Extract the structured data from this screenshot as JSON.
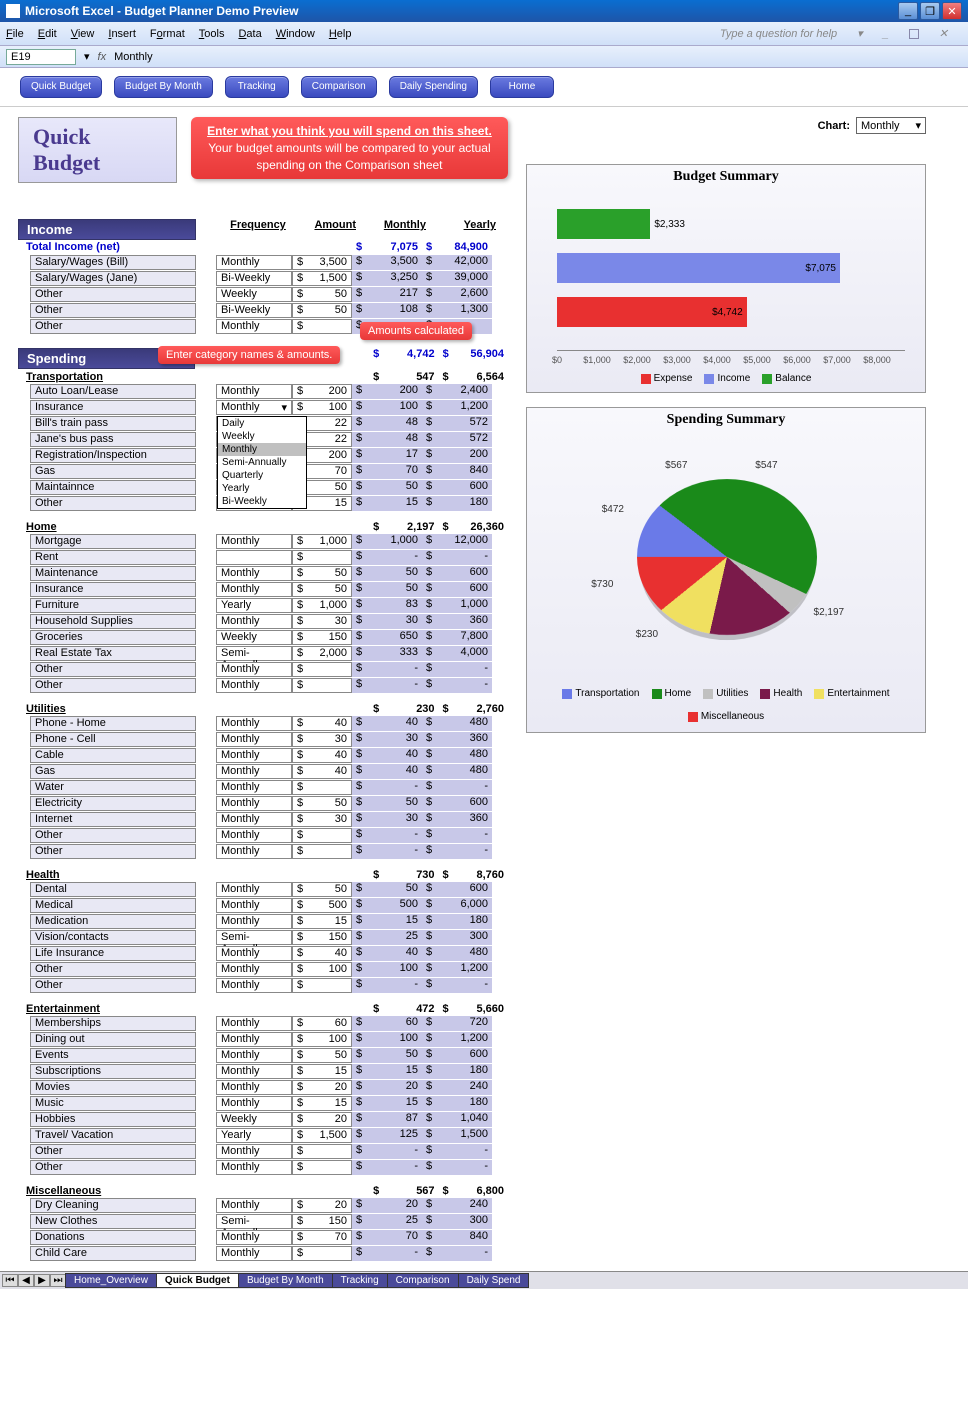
{
  "window": {
    "title": "Microsoft Excel - Budget Planner Demo Preview"
  },
  "menu": {
    "file": "File",
    "edit": "Edit",
    "view": "View",
    "insert": "Insert",
    "format": "Format",
    "tools": "Tools",
    "data": "Data",
    "window": "Window",
    "help": "Help",
    "question": "Type a question for help"
  },
  "formula": {
    "ref": "E19",
    "fx": "fx",
    "value": "Monthly"
  },
  "nav": {
    "quick": "Quick Budget",
    "month": "Budget By Month",
    "tracking": "Tracking",
    "comparison": "Comparison",
    "daily": "Daily Spending",
    "home": "Home"
  },
  "callouts": {
    "main_bold": "Enter what you think you will spend on this sheet.",
    "main_text": "Your budget amounts will be compared to your actual spending on the Comparison sheet",
    "amounts": "Amounts calculated",
    "categories": "Enter category names & amounts."
  },
  "page": {
    "title": "Quick Budget",
    "chart_label": "Chart:",
    "chart_value": "Monthly"
  },
  "headers": {
    "freq": "Frequency",
    "amount": "Amount",
    "monthly": "Monthly",
    "yearly": "Yearly"
  },
  "income": {
    "title": "Income",
    "total_label": "Total Income (net)",
    "total_monthly": "7,075",
    "total_yearly": "84,900",
    "rows": [
      {
        "name": "Salary/Wages (Bill)",
        "freq": "Monthly",
        "amount": "3,500",
        "monthly": "3,500",
        "yearly": "42,000"
      },
      {
        "name": "Salary/Wages (Jane)",
        "freq": "Bi-Weekly",
        "amount": "1,500",
        "monthly": "3,250",
        "yearly": "39,000"
      },
      {
        "name": "Other",
        "freq": "Weekly",
        "amount": "50",
        "monthly": "217",
        "yearly": "2,600"
      },
      {
        "name": "Other",
        "freq": "Bi-Weekly",
        "amount": "50",
        "monthly": "108",
        "yearly": "1,300"
      },
      {
        "name": "Other",
        "freq": "Monthly",
        "amount": "",
        "monthly": "",
        "yearly": ""
      }
    ]
  },
  "spending": {
    "title": "Spending",
    "total_monthly": "4,742",
    "total_yearly": "56,904"
  },
  "dropdown_options": [
    "Daily",
    "Weekly",
    "Monthly",
    "Semi-Annually",
    "Quarterly",
    "Yearly",
    "Bi-Weekly"
  ],
  "categories": [
    {
      "name": "Transportation",
      "monthly": "547",
      "yearly": "6,564",
      "rows": [
        {
          "name": "Auto Loan/Lease",
          "freq": "Monthly",
          "amount": "200",
          "monthly": "200",
          "yearly": "2,400"
        },
        {
          "name": "Insurance",
          "freq": "Monthly",
          "amount": "100",
          "monthly": "100",
          "yearly": "1,200",
          "dropdown": true
        },
        {
          "name": "Bill's train pass",
          "freq": "",
          "amount": "22",
          "monthly": "48",
          "yearly": "572"
        },
        {
          "name": "Jane's bus pass",
          "freq": "",
          "amount": "22",
          "monthly": "48",
          "yearly": "572"
        },
        {
          "name": "Registration/Inspection",
          "freq": "",
          "amount": "200",
          "monthly": "17",
          "yearly": "200"
        },
        {
          "name": "Gas",
          "freq": "",
          "amount": "70",
          "monthly": "70",
          "yearly": "840"
        },
        {
          "name": "Maintainnce",
          "freq": "",
          "amount": "50",
          "monthly": "50",
          "yearly": "600"
        },
        {
          "name": "Other",
          "freq": "Monthly",
          "amount": "15",
          "monthly": "15",
          "yearly": "180"
        }
      ]
    },
    {
      "name": "Home",
      "monthly": "2,197",
      "yearly": "26,360",
      "rows": [
        {
          "name": "Mortgage",
          "freq": "Monthly",
          "amount": "1,000",
          "monthly": "1,000",
          "yearly": "12,000"
        },
        {
          "name": "Rent",
          "freq": "",
          "amount": "",
          "monthly": "-",
          "yearly": "-"
        },
        {
          "name": "Maintenance",
          "freq": "Monthly",
          "amount": "50",
          "monthly": "50",
          "yearly": "600"
        },
        {
          "name": "Insurance",
          "freq": "Monthly",
          "amount": "50",
          "monthly": "50",
          "yearly": "600"
        },
        {
          "name": "Furniture",
          "freq": "Yearly",
          "amount": "1,000",
          "monthly": "83",
          "yearly": "1,000"
        },
        {
          "name": "Household Supplies",
          "freq": "Monthly",
          "amount": "30",
          "monthly": "30",
          "yearly": "360"
        },
        {
          "name": "Groceries",
          "freq": "Weekly",
          "amount": "150",
          "monthly": "650",
          "yearly": "7,800"
        },
        {
          "name": "Real Estate Tax",
          "freq": "Semi-Annually",
          "amount": "2,000",
          "monthly": "333",
          "yearly": "4,000"
        },
        {
          "name": "Other",
          "freq": "Monthly",
          "amount": "",
          "monthly": "-",
          "yearly": "-"
        },
        {
          "name": "Other",
          "freq": "Monthly",
          "amount": "",
          "monthly": "-",
          "yearly": "-"
        }
      ]
    },
    {
      "name": "Utilities",
      "monthly": "230",
      "yearly": "2,760",
      "rows": [
        {
          "name": "Phone - Home",
          "freq": "Monthly",
          "amount": "40",
          "monthly": "40",
          "yearly": "480"
        },
        {
          "name": "Phone - Cell",
          "freq": "Monthly",
          "amount": "30",
          "monthly": "30",
          "yearly": "360"
        },
        {
          "name": "Cable",
          "freq": "Monthly",
          "amount": "40",
          "monthly": "40",
          "yearly": "480"
        },
        {
          "name": "Gas",
          "freq": "Monthly",
          "amount": "40",
          "monthly": "40",
          "yearly": "480"
        },
        {
          "name": "Water",
          "freq": "Monthly",
          "amount": "",
          "monthly": "-",
          "yearly": "-"
        },
        {
          "name": "Electricity",
          "freq": "Monthly",
          "amount": "50",
          "monthly": "50",
          "yearly": "600"
        },
        {
          "name": "Internet",
          "freq": "Monthly",
          "amount": "30",
          "monthly": "30",
          "yearly": "360"
        },
        {
          "name": "Other",
          "freq": "Monthly",
          "amount": "",
          "monthly": "-",
          "yearly": "-"
        },
        {
          "name": "Other",
          "freq": "Monthly",
          "amount": "",
          "monthly": "-",
          "yearly": "-"
        }
      ]
    },
    {
      "name": "Health",
      "monthly": "730",
      "yearly": "8,760",
      "rows": [
        {
          "name": "Dental",
          "freq": "Monthly",
          "amount": "50",
          "monthly": "50",
          "yearly": "600"
        },
        {
          "name": "Medical",
          "freq": "Monthly",
          "amount": "500",
          "monthly": "500",
          "yearly": "6,000"
        },
        {
          "name": "Medication",
          "freq": "Monthly",
          "amount": "15",
          "monthly": "15",
          "yearly": "180"
        },
        {
          "name": "Vision/contacts",
          "freq": "Semi-Annually",
          "amount": "150",
          "monthly": "25",
          "yearly": "300"
        },
        {
          "name": "Life Insurance",
          "freq": "Monthly",
          "amount": "40",
          "monthly": "40",
          "yearly": "480"
        },
        {
          "name": "Other",
          "freq": "Monthly",
          "amount": "100",
          "monthly": "100",
          "yearly": "1,200"
        },
        {
          "name": "Other",
          "freq": "Monthly",
          "amount": "",
          "monthly": "-",
          "yearly": "-"
        }
      ]
    },
    {
      "name": "Entertainment",
      "monthly": "472",
      "yearly": "5,660",
      "rows": [
        {
          "name": "Memberships",
          "freq": "Monthly",
          "amount": "60",
          "monthly": "60",
          "yearly": "720"
        },
        {
          "name": "Dining out",
          "freq": "Monthly",
          "amount": "100",
          "monthly": "100",
          "yearly": "1,200"
        },
        {
          "name": "Events",
          "freq": "Monthly",
          "amount": "50",
          "monthly": "50",
          "yearly": "600"
        },
        {
          "name": "Subscriptions",
          "freq": "Monthly",
          "amount": "15",
          "monthly": "15",
          "yearly": "180"
        },
        {
          "name": "Movies",
          "freq": "Monthly",
          "amount": "20",
          "monthly": "20",
          "yearly": "240"
        },
        {
          "name": "Music",
          "freq": "Monthly",
          "amount": "15",
          "monthly": "15",
          "yearly": "180"
        },
        {
          "name": "Hobbies",
          "freq": "Weekly",
          "amount": "20",
          "monthly": "87",
          "yearly": "1,040"
        },
        {
          "name": "Travel/ Vacation",
          "freq": "Yearly",
          "amount": "1,500",
          "monthly": "125",
          "yearly": "1,500"
        },
        {
          "name": "Other",
          "freq": "Monthly",
          "amount": "",
          "monthly": "-",
          "yearly": "-"
        },
        {
          "name": "Other",
          "freq": "Monthly",
          "amount": "",
          "monthly": "-",
          "yearly": "-"
        }
      ]
    },
    {
      "name": "Miscellaneous",
      "monthly": "567",
      "yearly": "6,800",
      "rows": [
        {
          "name": "Dry Cleaning",
          "freq": "Monthly",
          "amount": "20",
          "monthly": "20",
          "yearly": "240"
        },
        {
          "name": "New Clothes",
          "freq": "Semi-Annually",
          "amount": "150",
          "monthly": "25",
          "yearly": "300"
        },
        {
          "name": "Donations",
          "freq": "Monthly",
          "amount": "70",
          "monthly": "70",
          "yearly": "840"
        },
        {
          "name": "Child Care",
          "freq": "Monthly",
          "amount": "",
          "monthly": "-",
          "yearly": "-"
        }
      ]
    }
  ],
  "charts": {
    "budget_title": "Budget Summary",
    "spending_title": "Spending Summary"
  },
  "bar_legend": {
    "expense": "Expense",
    "income": "Income",
    "balance": "Balance"
  },
  "pie_legend": {
    "transportation": "Transportation",
    "home": "Home",
    "utilities": "Utilities",
    "health": "Health",
    "entertainment": "Entertainment",
    "misc": "Miscellaneous"
  },
  "chart_data": [
    {
      "type": "bar",
      "title": "Budget Summary",
      "orientation": "horizontal",
      "categories": [
        "Balance",
        "Income",
        "Expense"
      ],
      "values": [
        2333,
        7075,
        4742
      ],
      "colors": [
        "#2aa02a",
        "#7a88e8",
        "#e83030"
      ],
      "xlim": [
        0,
        8000
      ],
      "ticks": [
        0,
        1000,
        2000,
        3000,
        4000,
        5000,
        6000,
        7000,
        8000
      ],
      "tick_labels": [
        "$0",
        "$1,000",
        "$2,000",
        "$3,000",
        "$4,000",
        "$5,000",
        "$6,000",
        "$7,000",
        "$8,000"
      ]
    },
    {
      "type": "pie",
      "title": "Spending Summary",
      "series": [
        {
          "name": "Transportation",
          "value": 547,
          "color": "#6a7ae8"
        },
        {
          "name": "Home",
          "value": 2197,
          "color": "#1a8a1a"
        },
        {
          "name": "Utilities",
          "value": 230,
          "color": "#c0c0c0"
        },
        {
          "name": "Health",
          "value": 730,
          "color": "#7a1a4a"
        },
        {
          "name": "Entertainment",
          "value": 472,
          "color": "#f0e060"
        },
        {
          "name": "Miscellaneous",
          "value": 567,
          "color": "#e83030"
        }
      ],
      "labels": [
        "$547",
        "$2,197",
        "$230",
        "$730",
        "$472",
        "$567"
      ]
    }
  ],
  "tabs": {
    "home": "Home_Overview",
    "quick": "Quick Budget",
    "month": "Budget By Month",
    "tracking": "Tracking",
    "comparison": "Comparison",
    "daily": "Daily Spend"
  }
}
